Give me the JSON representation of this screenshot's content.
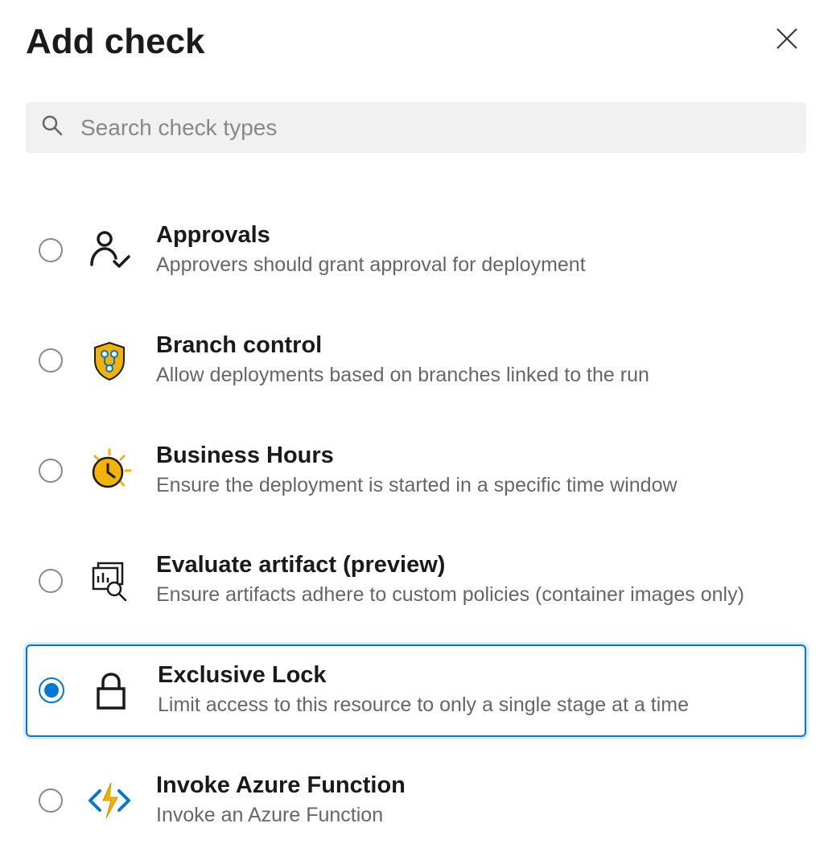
{
  "dialog": {
    "title": "Add check"
  },
  "search": {
    "placeholder": "Search check types",
    "value": ""
  },
  "checks": [
    {
      "id": "approvals",
      "icon": "person-check-icon",
      "title": "Approvals",
      "description": "Approvers should grant approval for deployment",
      "selected": false
    },
    {
      "id": "branch-control",
      "icon": "branch-shield-icon",
      "title": "Branch control",
      "description": "Allow deployments based on branches linked to the run",
      "selected": false
    },
    {
      "id": "business-hours",
      "icon": "clock-sun-icon",
      "title": "Business Hours",
      "description": "Ensure the deployment is started in a specific time window",
      "selected": false
    },
    {
      "id": "evaluate-artifact",
      "icon": "artifact-search-icon",
      "title": "Evaluate artifact (preview)",
      "description": "Ensure artifacts adhere to custom policies (container images only)",
      "selected": false
    },
    {
      "id": "exclusive-lock",
      "icon": "lock-icon",
      "title": "Exclusive Lock",
      "description": "Limit access to this resource to only a single stage at a time",
      "selected": true
    },
    {
      "id": "invoke-azure-function",
      "icon": "azure-function-icon",
      "title": "Invoke Azure Function",
      "description": "Invoke an Azure Function",
      "selected": false
    }
  ]
}
